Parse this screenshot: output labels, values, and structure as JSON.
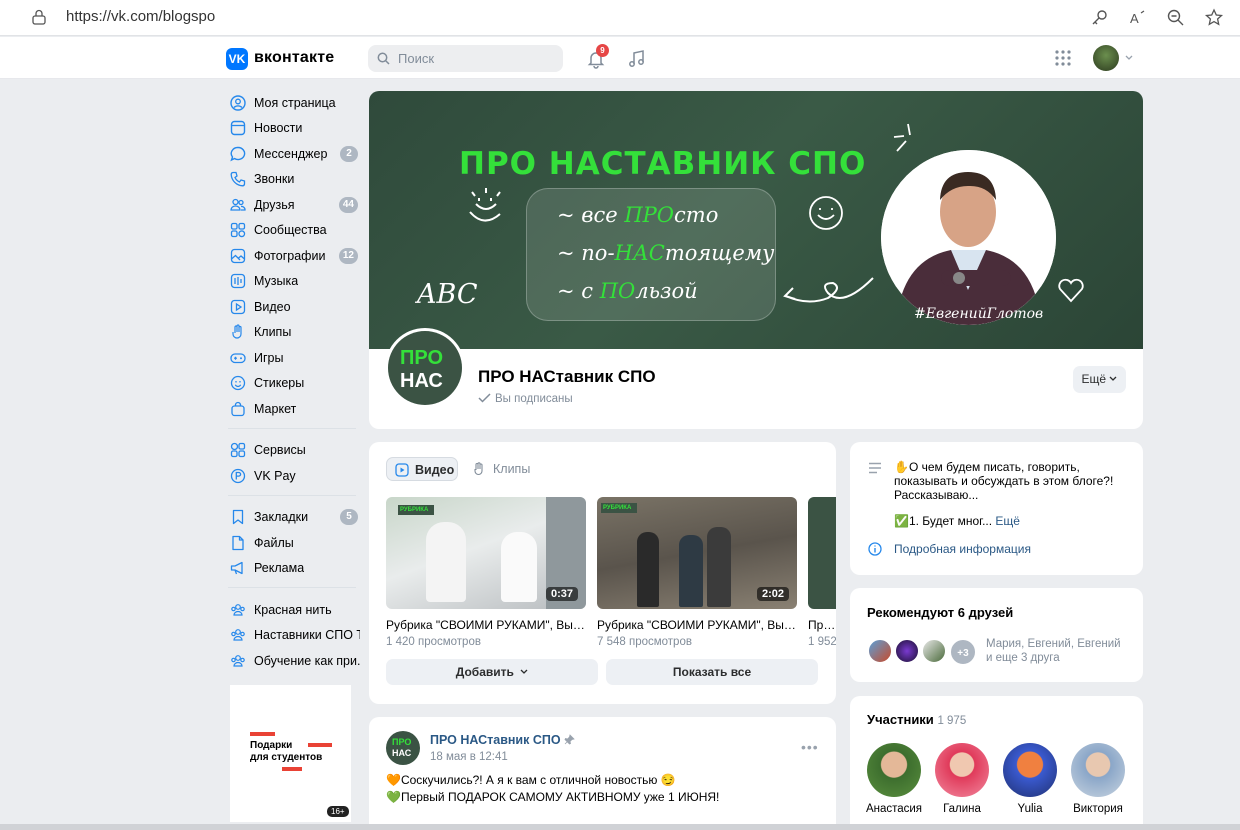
{
  "browser": {
    "url": "https://vk.com/blogspo"
  },
  "header": {
    "logo_text": "вконтакте",
    "logo_mark": "VK",
    "search_placeholder": "Поиск",
    "notifications_count": "9"
  },
  "sidebar": {
    "items": [
      {
        "label": "Моя страница",
        "icon": "user-icon"
      },
      {
        "label": "Новости",
        "icon": "news-icon"
      },
      {
        "label": "Мессенджер",
        "icon": "message-icon",
        "count": "2"
      },
      {
        "label": "Звонки",
        "icon": "phone-icon"
      },
      {
        "label": "Друзья",
        "icon": "friends-icon",
        "count": "44"
      },
      {
        "label": "Сообщества",
        "icon": "communities-icon"
      },
      {
        "label": "Фотографии",
        "icon": "photo-icon",
        "count": "12"
      },
      {
        "label": "Музыка",
        "icon": "music-icon"
      },
      {
        "label": "Видео",
        "icon": "video-icon"
      },
      {
        "label": "Клипы",
        "icon": "clips-icon"
      },
      {
        "label": "Игры",
        "icon": "gamepad-icon"
      },
      {
        "label": "Стикеры",
        "icon": "sticker-icon"
      },
      {
        "label": "Маркет",
        "icon": "market-icon"
      },
      {
        "label": "Сервисы",
        "icon": "services-icon"
      },
      {
        "label": "VK Pay",
        "icon": "vkpay-icon"
      },
      {
        "label": "Закладки",
        "icon": "bookmark-icon",
        "count": "5"
      },
      {
        "label": "Файлы",
        "icon": "file-icon"
      },
      {
        "label": "Реклама",
        "icon": "ads-icon"
      },
      {
        "label": "Красная нить",
        "icon": "group-icon"
      },
      {
        "label": "Наставники СПО Т...",
        "icon": "group-icon"
      },
      {
        "label": "Обучение как при...",
        "icon": "group-icon"
      }
    ],
    "promo": {
      "line1": "Подарки",
      "line2": "для студентов",
      "age": "16+"
    }
  },
  "cover": {
    "title": "ПРО НАСТАВНИК СПО",
    "lines": [
      {
        "pre": "~ все ",
        "accent": "ПРО",
        "post": "сто"
      },
      {
        "pre": "~ по-",
        "accent": "НАС",
        "post": "тоящему"
      },
      {
        "pre": "~ с ",
        "accent": "ПО",
        "post": "льзой"
      }
    ],
    "abc": "ABC",
    "hashtag": "#ЕвгенийГлотов",
    "accent_color": "#34e03a"
  },
  "group": {
    "avatar_top": "ПРО",
    "avatar_bottom": "НАС",
    "name": "ПРО НАСтавник СПО",
    "status": "Вы подписаны",
    "more_button": "Ещё"
  },
  "videos": {
    "tabs": [
      {
        "label": "Видео",
        "active": true
      },
      {
        "label": "Клипы",
        "active": false
      }
    ],
    "items": [
      {
        "title": "Рубрика \"СВОИМИ РУКАМИ\", Выпу...",
        "views": "1 420 просмотров",
        "duration": "0:37"
      },
      {
        "title": "Рубрика \"СВОИМИ РУКАМИ\", Выпу...",
        "views": "7 548 просмотров",
        "duration": "2:02"
      },
      {
        "title": "Про П",
        "views": "1 952",
        "duration": ""
      }
    ],
    "thumb_badge": "РУБРИКА",
    "add_button": "Добавить",
    "show_all_button": "Показать все"
  },
  "post": {
    "author": "ПРО НАСтавник СПО",
    "date": "18 мая в 12:41",
    "line1": "🧡Соскучились?! А я к вам с отличной новостью 😏",
    "line2": "💚Первый ПОДАРОК САМОМУ АКТИВНОМУ уже 1 ИЮНЯ!"
  },
  "info": {
    "text1": "✋О чем будем писать, говорить,",
    "text2": "показывать и обсуждать в этом блоге?!",
    "text3": "Рассказываю...",
    "text4": "✅1. Будет мног...",
    "more": "Ещё",
    "details_link": "Подробная информация"
  },
  "recommend": {
    "title": "Рекомендуют 6 друзей",
    "more_count": "+3",
    "names_line1": "Мария, Евгений, Евгений",
    "names_line2": "и еще 3 друга"
  },
  "members": {
    "title": "Участники",
    "count": "1 975",
    "items": [
      {
        "name": "Анастасия"
      },
      {
        "name": "Галина"
      },
      {
        "name": "Yulia"
      },
      {
        "name": "Виктория"
      }
    ]
  }
}
